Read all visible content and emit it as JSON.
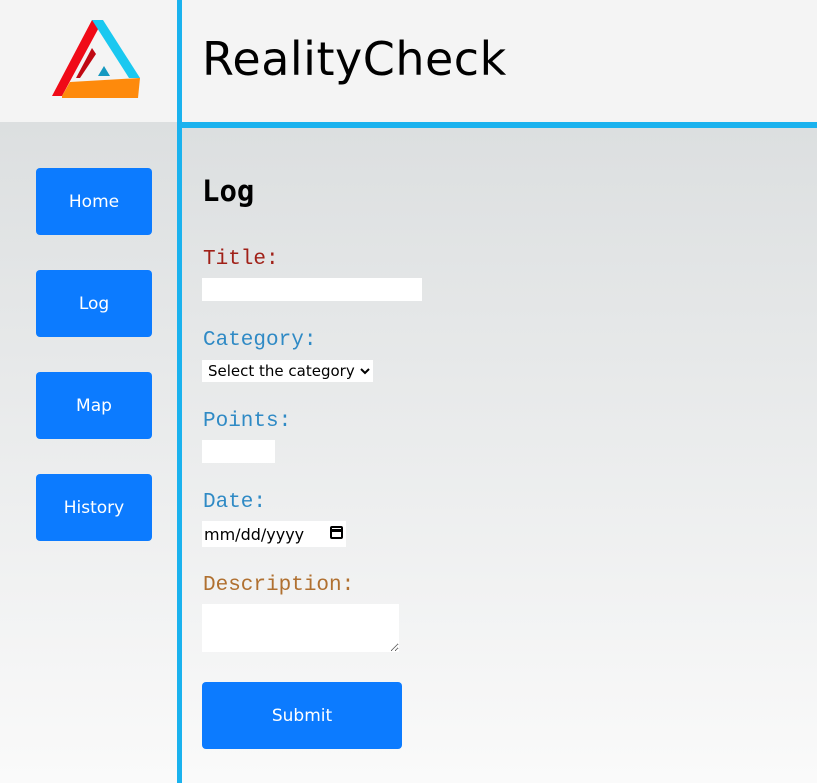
{
  "header": {
    "app_title": "RealityCheck"
  },
  "logo": {
    "icon": "impossible-triangle-logo",
    "colors": [
      "#f00a17",
      "#1ac8f0",
      "#fe8a0c"
    ]
  },
  "nav": {
    "items": [
      {
        "label": "Home"
      },
      {
        "label": "Log"
      },
      {
        "label": "Map"
      },
      {
        "label": "History"
      }
    ]
  },
  "page": {
    "heading": "Log"
  },
  "form": {
    "title": {
      "label": "Title:",
      "value": "",
      "color": "#a02018"
    },
    "category": {
      "label": "Category:",
      "selected": "Select the category",
      "color": "#2f8ac5"
    },
    "points": {
      "label": "Points:",
      "value": "",
      "color": "#2f8ac5"
    },
    "date": {
      "label": "Date:",
      "placeholder": "mm/dd/yyyy",
      "color": "#2f8ac5"
    },
    "description": {
      "label": "Description:",
      "value": "",
      "color": "#b07030"
    },
    "submit_label": "Submit"
  },
  "theme": {
    "accent": "#1ab2ee",
    "button": "#0c7bff"
  }
}
